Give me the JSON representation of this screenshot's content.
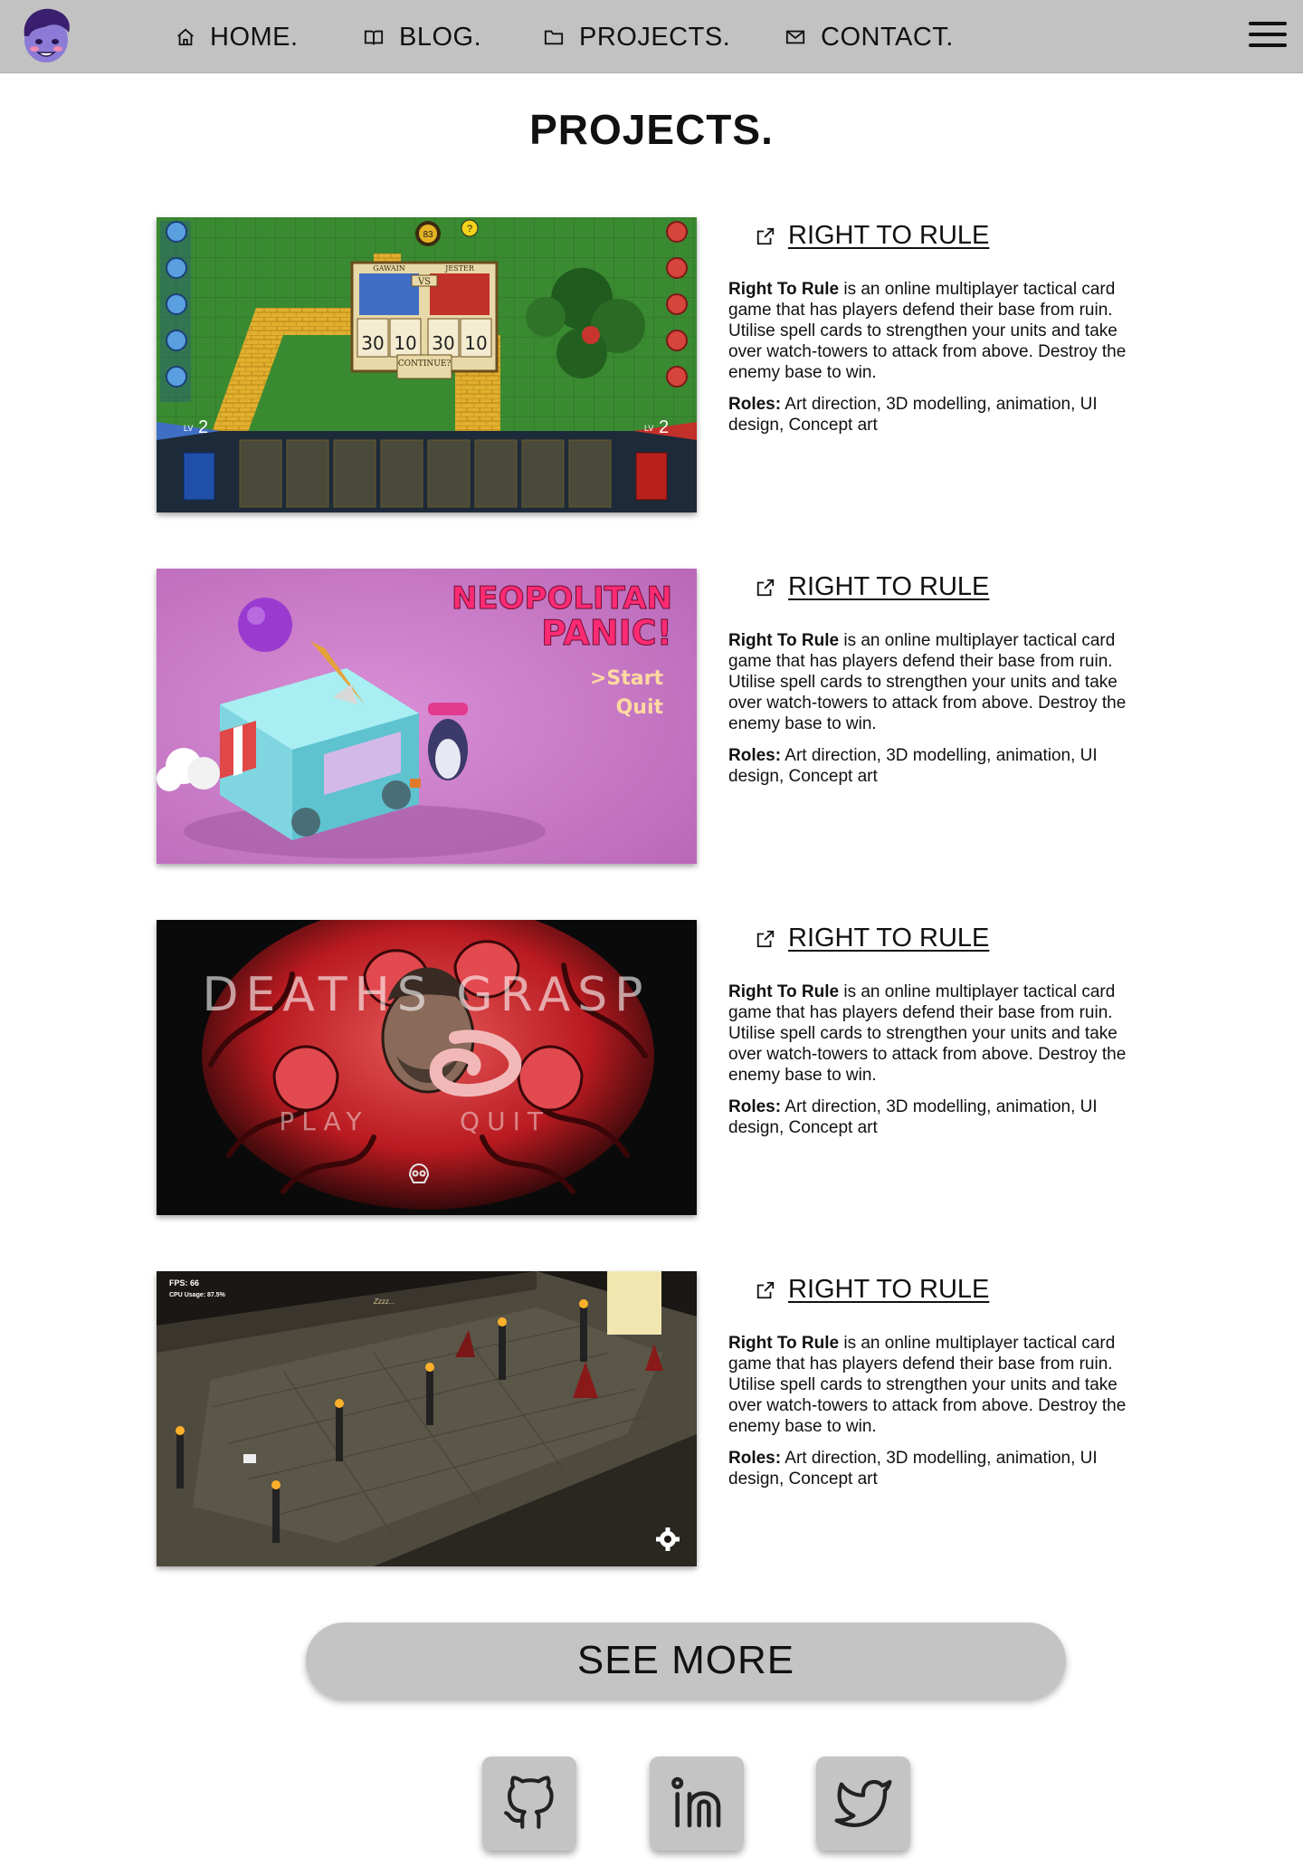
{
  "nav": {
    "items": [
      {
        "label": "HOME.",
        "icon": "home-icon"
      },
      {
        "label": "BLOG.",
        "icon": "book-icon"
      },
      {
        "label": "PROJECTS.",
        "icon": "folder-icon"
      },
      {
        "label": "CONTACT.",
        "icon": "mail-icon"
      }
    ],
    "menu_icon": "hamburger-menu-icon",
    "avatar_icon": "avatar-logo"
  },
  "page_title": "PROJECTS.",
  "projects": [
    {
      "title": "RIGHT TO RULE",
      "desc_bold": "Right To Rule",
      "desc_rest": " is an online multiplayer tactical card game that has players defend their base from ruin. Utilise spell cards to strengthen your units and take over watch-towers to attack from above. Destroy the enemy base to win.",
      "roles_label": "Roles:",
      "roles_rest": " Art direction, 3D modelling, animation, UI design, Concept art",
      "image": "card-battle-game-screenshot",
      "image_text": {
        "names": [
          "GAWAIN",
          "JESTER"
        ],
        "vs": "VS",
        "stats": [
          "30",
          "10",
          "30",
          "10"
        ],
        "continue": "CONTINUE?",
        "coin": "83",
        "help": "?",
        "level": "LV",
        "level_num": "2"
      }
    },
    {
      "title": "RIGHT TO RULE",
      "desc_bold": "Right To Rule",
      "desc_rest": " is an online multiplayer tactical card game that has players defend their base from ruin. Utilise spell cards to strengthen your units and take over watch-towers to attack from above. Destroy the enemy base to win.",
      "roles_label": "Roles:",
      "roles_rest": " Art direction, 3D modelling, animation, UI design, Concept art",
      "image": "ice-cream-van-game-screenshot",
      "image_text": {
        "title_line1": "NEOPOLITAN",
        "title_line2": "PANIC!",
        "menu_start": ">Start",
        "menu_quit": "Quit"
      }
    },
    {
      "title": "RIGHT TO RULE",
      "desc_bold": "Right To Rule",
      "desc_rest": " is an online multiplayer tactical card game that has players defend their base from ruin. Utilise spell cards to strengthen your units and take over watch-towers to attack from above. Destroy the enemy base to win.",
      "roles_label": "Roles:",
      "roles_rest": " Art direction, 3D modelling, animation, UI design, Concept art",
      "image": "deaths-grasp-game-screenshot",
      "image_text": {
        "title": "DEATHS GRASP",
        "play": "PLAY",
        "quit": "QUIT"
      }
    },
    {
      "title": "RIGHT TO RULE",
      "desc_bold": "Right To Rule",
      "desc_rest": " is an online multiplayer tactical card game that has players defend their base from ruin. Utilise spell cards to strengthen your units and take over watch-towers to attack from above. Destroy the enemy base to win.",
      "roles_label": "Roles:",
      "roles_rest": " Art direction, 3D modelling, animation, UI design, Concept art",
      "image": "dungeon-isometric-game-screenshot",
      "image_text": {
        "fps": "FPS: 66",
        "cpu": "CPU Usage: 87.5%",
        "zzz": "Zzzz..."
      }
    }
  ],
  "see_more": "SEE MORE",
  "social": [
    {
      "name": "github-icon"
    },
    {
      "name": "linkedin-icon"
    },
    {
      "name": "twitter-icon"
    }
  ],
  "colors": {
    "nav_bg": "#c2c2c2",
    "button_bg": "#c4c4c4",
    "text": "#111111"
  }
}
